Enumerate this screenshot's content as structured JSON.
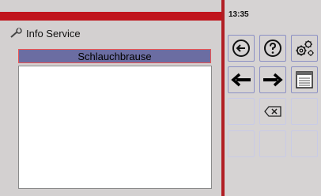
{
  "header": {
    "title": "Info Service",
    "title_icon": "wrench-icon"
  },
  "list": {
    "selected_label": "Schlauchbrause",
    "items": []
  },
  "status": {
    "time": "13:35"
  },
  "keypad": {
    "row1": [
      "back-icon",
      "help-icon",
      "settings-gears-icon"
    ],
    "row2": [
      "arrow-left-icon",
      "arrow-right-icon",
      "window-icon"
    ],
    "row3": [
      "",
      "backspace-icon",
      ""
    ],
    "row4": [
      "",
      "",
      ""
    ]
  },
  "colors": {
    "accent_red": "#c0141c",
    "selection": "#6b6da2",
    "key_border": "#c9cbe6"
  }
}
